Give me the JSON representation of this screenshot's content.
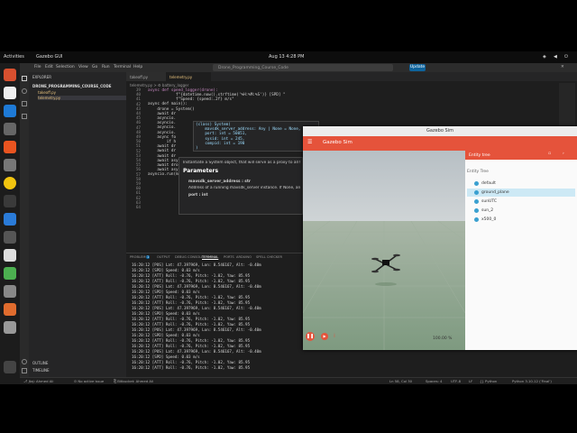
{
  "topbar": {
    "activities": "Activities",
    "app": "Gazebo GUI",
    "clock": "Aug 13  4:28 PM"
  },
  "vscode": {
    "menu": [
      "File",
      "Edit",
      "Selection",
      "View",
      "Go",
      "Run",
      "Terminal",
      "Help"
    ],
    "search": "Drone_Programming_Course_Code",
    "update": "Update",
    "explorer_title": "EXPLORER",
    "folder": "DRONE_PROGRAMMING_COURSE_CODE",
    "files": [
      "takeoff.py",
      "telemetry.py"
    ],
    "outline": "OUTLINE",
    "timeline": "TIMELINE",
    "tabs": [
      "takeoff.py",
      "telemetry.py"
    ],
    "breadcrumb": "telemetry.py > ⚙ battery_logger",
    "code_lines": [
      "            f\"{datetime.now().strftime('%H:%M:%S')} [SPD] \"",
      "            f\"Speed: {speed:.2f} m/s\"",
      "",
      "",
      "async def main():",
      "    drone = System()",
      "    await dr",
      "",
      "    asyncio.",
      "    asyncio.",
      "    asyncio.",
      "    asyncio.",
      "",
      "    async fo",
      "        if h",
      "",
      "    await dr",
      "    await dr",
      "    await dr",
      "    await asyncio.sleep(10)",
      "    await drone.action.land()",
      "    await asyncio.sleep(30)",
      "",
      "asyncio.run(main())"
    ],
    "code_header": "async def speed_logger(drone):",
    "line_numbers": [
      "39",
      "40",
      "41",
      "42",
      "43",
      "44",
      "45",
      "46",
      "47",
      "48",
      "49",
      "50",
      "51",
      "52",
      "53",
      "54",
      "55",
      "56",
      "57",
      "58",
      "59",
      "60",
      "61",
      "62",
      "63",
      "64"
    ],
    "hover_sig": [
      "(class) System(",
      "    mavsdk_server_address: Any | None = None,",
      "    port: int = 50051,",
      "    sysid: int = 245,",
      "    compid: int = 190",
      ")"
    ],
    "tooltip": {
      "line1": "Instantiate a System object, that will serve as a proxy to all the MAVSDK",
      "heading": "Parameters",
      "param1": "mavsdk_server_address : str",
      "desc1": "Address of a running mavsdk_server instance. If None, an instance of",
      "param2": "port : int"
    },
    "terminal_tabs": [
      "PROBLEMS",
      "OUTPUT",
      "DEBUG CONSOLE",
      "TERMINAL",
      "PORTS",
      "ARDUINO",
      "SPELL CHECKER"
    ],
    "terminal_badge": "1",
    "terminal_lines": [
      "16:20:12 [POS] Lat: 47.397969, Lon: 8.546167, Alt: -0.40m",
      "16:20:12 [SPD] Speed: 0.03 m/s",
      "16:20:12 [ATT] Roll: -0.76, Pitch: -1.02, Yaw: 85.95",
      "16:20:12 [ATT] Roll: -0.76, Pitch: -1.02, Yaw: 85.95",
      "16:20:12 [POS] Lat: 47.397969, Lon: 8.546167, Alt: -0.40m",
      "16:20:12 [SPD] Speed: 0.03 m/s",
      "16:20:12 [ATT] Roll: -0.76, Pitch: -1.02, Yaw: 85.95",
      "16:20:12 [ATT] Roll: -0.76, Pitch: -1.02, Yaw: 85.95",
      "16:20:12 [POS] Lat: 47.397969, Lon: 8.546167, Alt: -0.40m",
      "16:20:12 [SPD] Speed: 0.03 m/s",
      "16:20:12 [ATT] Roll: -0.76, Pitch: -1.02, Yaw: 85.95",
      "16:20:12 [ATT] Roll: -0.76, Pitch: -1.02, Yaw: 85.95",
      "16:20:12 [POS] Lat: 47.397969, Lon: 8.546167, Alt: -0.40m",
      "16:20:12 [SPD] Speed: 0.03 m/s",
      "16:20:12 [ATT] Roll: -0.76, Pitch: -1.02, Yaw: 85.95",
      "16:20:12 [ATT] Roll: -0.76, Pitch: -1.02, Yaw: 85.95",
      "16:20:12 [POS] Lat: 47.397969, Lon: 8.546167, Alt: -0.40m",
      "16:20:12 [SPD] Speed: 0.03 m/s",
      "16:20:12 [ATT] Roll: -0.76, Pitch: -1.02, Yaw: 85.95",
      "16:20:12 [ATT] Roll: -0.76, Pitch: -1.02, Yaw: 85.95"
    ],
    "status_left": [
      "⎇ Jtaj: Ahmed Ali",
      "⊙ No active issue",
      "⎘ Bitbucket: Ahmed Ali"
    ],
    "status_right": [
      "Ln 58, Col 30",
      "Spaces: 4",
      "UTF-8",
      "LF",
      "{} Python",
      "Python 3.10.12 ('Final')"
    ]
  },
  "gazebo": {
    "title": "Gazebo Sim",
    "app_title": "Gazebo Sim",
    "panel_title": "Entity tree",
    "section": "Entity Tree",
    "entities": [
      "default",
      "ground_plane",
      "sunUTC",
      "sun_2",
      "x500_0"
    ],
    "zoom": "100.00 %",
    "colors": {
      "accent": "#e5533b",
      "selected": "#cde9f5"
    }
  }
}
